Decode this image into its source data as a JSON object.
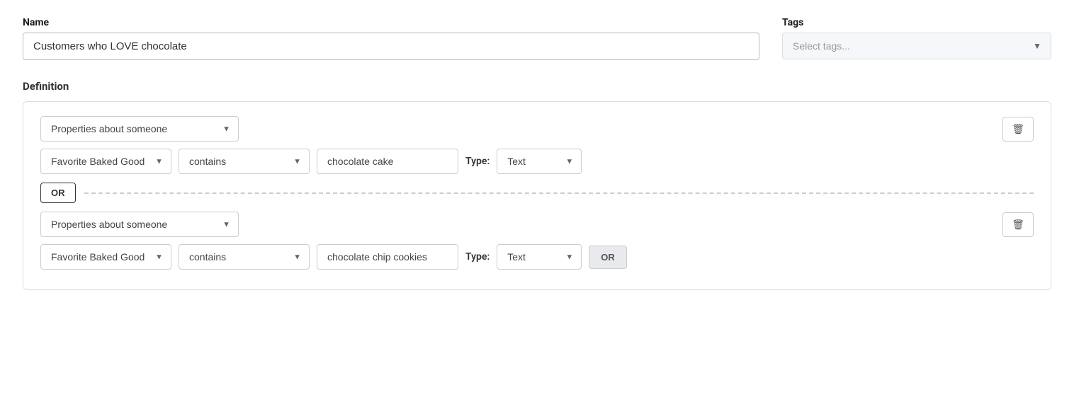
{
  "header": {
    "name_label": "Name",
    "name_value": "Customers who LOVE chocolate",
    "tags_label": "Tags",
    "tags_placeholder": "Select tags..."
  },
  "definition": {
    "title": "Definition",
    "condition_groups": [
      {
        "id": "group1",
        "properties_value": "Properties about someone",
        "field_value": "Favorite Baked Good(s)",
        "operator_value": "contains",
        "value": "chocolate cake",
        "type_label": "Type:",
        "type_value": "Text"
      },
      {
        "id": "group2",
        "properties_value": "Properties about someone",
        "field_value": "Favorite Baked Good(s)",
        "operator_value": "contains",
        "value": "chocolate chip cookies",
        "type_label": "Type:",
        "type_value": "Text"
      }
    ],
    "or_label": "OR",
    "or_add_label": "OR",
    "delete_icon": "🗑"
  }
}
